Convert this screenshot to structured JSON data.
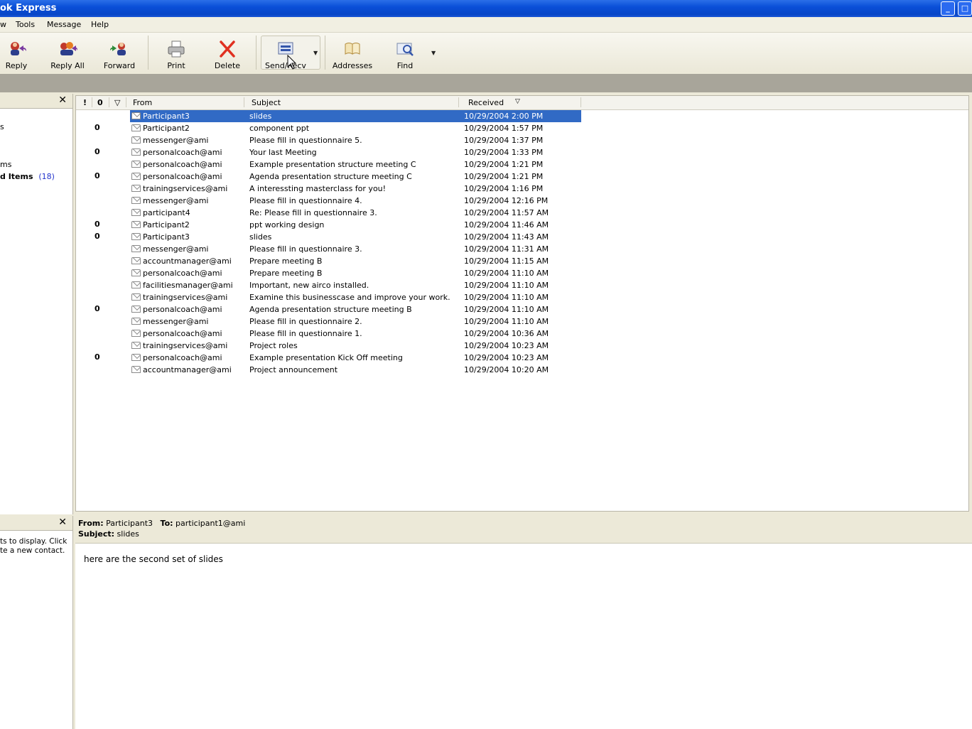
{
  "window": {
    "title": "ok Express"
  },
  "menu": {
    "items": [
      "w",
      "Tools",
      "Message",
      "Help"
    ]
  },
  "toolbar": {
    "reply": "Reply",
    "reply_all": "Reply All",
    "forward": "Forward",
    "print": "Print",
    "delete": "Delete",
    "send_recv": "Send/Recv",
    "addresses": "Addresses",
    "find": "Find"
  },
  "folders": {
    "items": [
      {
        "label": "s"
      },
      {
        "label": "ms"
      },
      {
        "label": "d Items",
        "count": "(18)"
      }
    ]
  },
  "contacts": {
    "line1": "ts to display. Click",
    "line2": "te a new contact."
  },
  "message_list": {
    "columns": {
      "priority": "!",
      "attachment": "0",
      "flag": "▽",
      "from": "From",
      "subject": "Subject",
      "received": "Received",
      "sort_indicator": "▽"
    },
    "rows": [
      {
        "attach": true,
        "from": "Participant3",
        "subject": "slides",
        "received": "10/29/2004 2:00 PM",
        "selected": true
      },
      {
        "attach": true,
        "from": "Participant2",
        "subject": "component ppt",
        "received": "10/29/2004 1:57 PM"
      },
      {
        "attach": false,
        "from": "messenger@ami",
        "subject": "Please fill in questionnaire 5.",
        "received": "10/29/2004 1:37 PM"
      },
      {
        "attach": true,
        "from": "personalcoach@ami",
        "subject": "Your last Meeting",
        "received": "10/29/2004 1:33 PM"
      },
      {
        "attach": false,
        "from": "personalcoach@ami",
        "subject": "Example presentation structure meeting C",
        "received": "10/29/2004 1:21 PM"
      },
      {
        "attach": true,
        "from": "personalcoach@ami",
        "subject": "Agenda presentation structure meeting C",
        "received": "10/29/2004 1:21 PM"
      },
      {
        "attach": false,
        "from": "trainingservices@ami",
        "subject": "A interessting masterclass for you!",
        "received": "10/29/2004 1:16 PM"
      },
      {
        "attach": false,
        "from": "messenger@ami",
        "subject": "Please fill in questionnaire 4.",
        "received": "10/29/2004 12:16 PM"
      },
      {
        "attach": false,
        "from": "participant4",
        "subject": "Re: Please fill in questionnaire 3.",
        "received": "10/29/2004 11:57 AM"
      },
      {
        "attach": true,
        "from": "Participant2",
        "subject": "ppt working design",
        "received": "10/29/2004 11:46 AM"
      },
      {
        "attach": true,
        "from": "Participant3",
        "subject": "slides",
        "received": "10/29/2004 11:43 AM"
      },
      {
        "attach": false,
        "from": "messenger@ami",
        "subject": "Please fill in questionnaire 3.",
        "received": "10/29/2004 11:31 AM"
      },
      {
        "attach": false,
        "from": "accountmanager@ami",
        "subject": "Prepare meeting B",
        "received": "10/29/2004 11:15 AM"
      },
      {
        "attach": false,
        "from": "personalcoach@ami",
        "subject": "Prepare meeting B",
        "received": "10/29/2004 11:10 AM"
      },
      {
        "attach": false,
        "from": "facilitiesmanager@ami",
        "subject": "Important, new airco installed.",
        "received": "10/29/2004 11:10 AM"
      },
      {
        "attach": false,
        "from": "trainingservices@ami",
        "subject": "Examine this businesscase and improve your work.",
        "received": "10/29/2004 11:10 AM"
      },
      {
        "attach": true,
        "from": "personalcoach@ami",
        "subject": "Agenda presentation structure meeting B",
        "received": "10/29/2004 11:10 AM"
      },
      {
        "attach": false,
        "from": "messenger@ami",
        "subject": "Please fill in questionnaire 2.",
        "received": "10/29/2004 11:10 AM"
      },
      {
        "attach": false,
        "from": "personalcoach@ami",
        "subject": "Please fill in questionnaire 1.",
        "received": "10/29/2004 10:36 AM"
      },
      {
        "attach": false,
        "from": "trainingservices@ami",
        "subject": "Project roles",
        "received": "10/29/2004 10:23 AM"
      },
      {
        "attach": true,
        "from": "personalcoach@ami",
        "subject": "Example presentation Kick Off meeting",
        "received": "10/29/2004 10:23 AM"
      },
      {
        "attach": false,
        "from": "accountmanager@ami",
        "subject": "Project announcement",
        "received": "10/29/2004 10:20 AM"
      }
    ]
  },
  "preview": {
    "from_label": "From:",
    "from": "Participant3",
    "to_label": "To:",
    "to": "participant1@ami",
    "subject_label": "Subject:",
    "subject": "slides",
    "body": "here are the second set of slides"
  },
  "colors": {
    "titlebar": "#0a4fd8",
    "selection": "#316ac5",
    "delete_icon": "#e03020"
  }
}
